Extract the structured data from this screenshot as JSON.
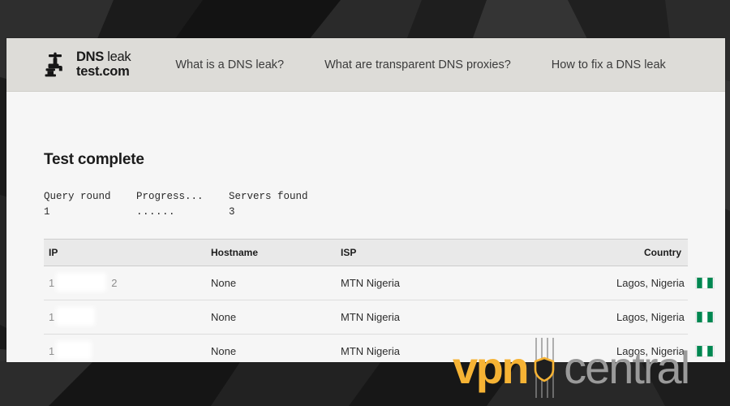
{
  "site": {
    "brand": {
      "icon": "faucet-tap-icon",
      "line1_bold": "DNS",
      "line1_regular": "leak",
      "line2": "test.com"
    },
    "nav": [
      {
        "label": "What is a DNS leak?"
      },
      {
        "label": "What are transparent DNS proxies?"
      },
      {
        "label": "How to fix a DNS leak"
      }
    ]
  },
  "content": {
    "title": "Test complete",
    "status": [
      {
        "label": "Query round",
        "value": "1"
      },
      {
        "label": "Progress...",
        "value": "......"
      },
      {
        "label": "Servers found",
        "value": "3"
      }
    ],
    "table": {
      "headers": {
        "ip": "IP",
        "hostname": "Hostname",
        "isp": "ISP",
        "country": "Country"
      },
      "rows": [
        {
          "ip_prefix": "1",
          "ip_suffix": "2",
          "ip_redacted": true,
          "hostname": "None",
          "isp": "MTN Nigeria",
          "country": "Lagos, Nigeria",
          "flag": "nigeria-flag-icon"
        },
        {
          "ip_prefix": "1",
          "ip_suffix": "",
          "ip_redacted": true,
          "hostname": "None",
          "isp": "MTN Nigeria",
          "country": "Lagos, Nigeria",
          "flag": "nigeria-flag-icon"
        },
        {
          "ip_prefix": "1",
          "ip_suffix": "",
          "ip_redacted": true,
          "hostname": "None",
          "isp": "MTN Nigeria",
          "country": "Lagos, Nigeria",
          "flag": "nigeria-flag-icon"
        }
      ]
    }
  },
  "watermark": {
    "vpn_text": "vpn",
    "central_text": "central",
    "shield_icon": "shield-icon"
  },
  "colors": {
    "accent_yellow": "#f6b334",
    "watermark_gray": "#9a9a9a",
    "header_bg": "#dddcd8",
    "page_bg": "#f6f6f6",
    "backdrop_dark": "#232323",
    "flag_green": "#008751",
    "flag_white": "#ffffff"
  }
}
